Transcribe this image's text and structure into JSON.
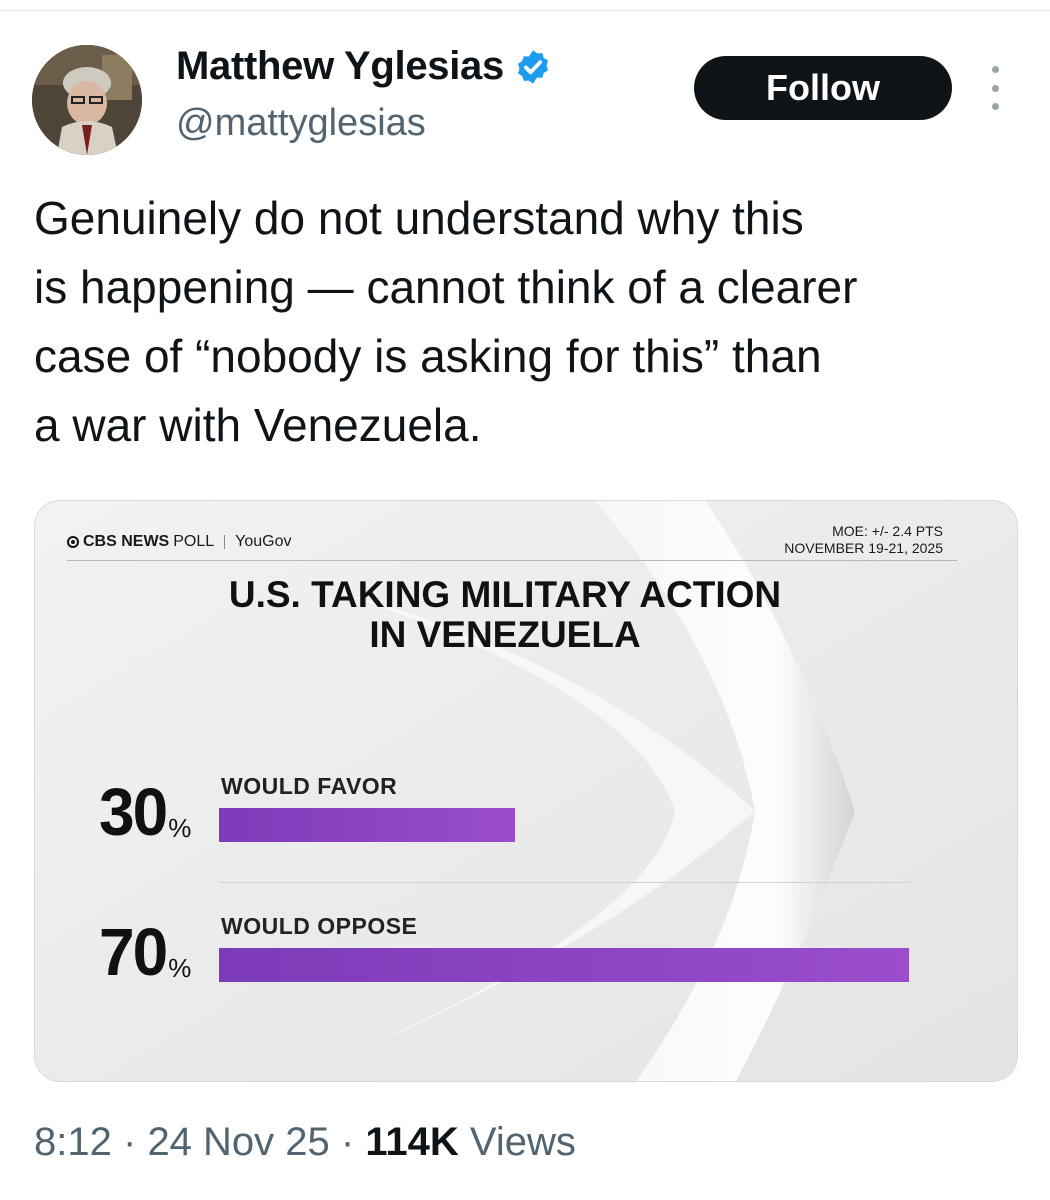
{
  "author": {
    "name": "Matthew Yglesias",
    "handle": "@mattyglesias",
    "verified_color": "#1d9bf0"
  },
  "actions": {
    "follow_label": "Follow",
    "more_icon": "more-vertical-icon"
  },
  "tweet": {
    "lines": [
      "Genuinely do not understand why this",
      "is happening — cannot think of a clearer",
      "case of “nobody is asking for this” than",
      "a war with Venezuela."
    ]
  },
  "media": {
    "brand_cbs": "CBS NEWS",
    "brand_poll": "POLL",
    "brand_yougov": "YouGov",
    "moe": "MOE: +/- 2.4 PTS",
    "dates": "NOVEMBER 19-21, 2025",
    "title_line1": "U.S. TAKING MILITARY ACTION",
    "title_line2": "IN VENEZUELA",
    "accent_color": "#8e44c6"
  },
  "chart_data": {
    "type": "bar",
    "title": "U.S. TAKING MILITARY ACTION IN VENEZUELA",
    "categories": [
      "WOULD FAVOR",
      "WOULD OPPOSE"
    ],
    "values": [
      30,
      70
    ],
    "value_labels": [
      "30",
      "70"
    ],
    "unit": "%",
    "ylim": [
      0,
      100
    ]
  },
  "footer": {
    "time": "8:12",
    "sep1": "·",
    "date": "24 Nov 25",
    "sep2": "·",
    "views_count": "114K",
    "views_label": "Views"
  }
}
